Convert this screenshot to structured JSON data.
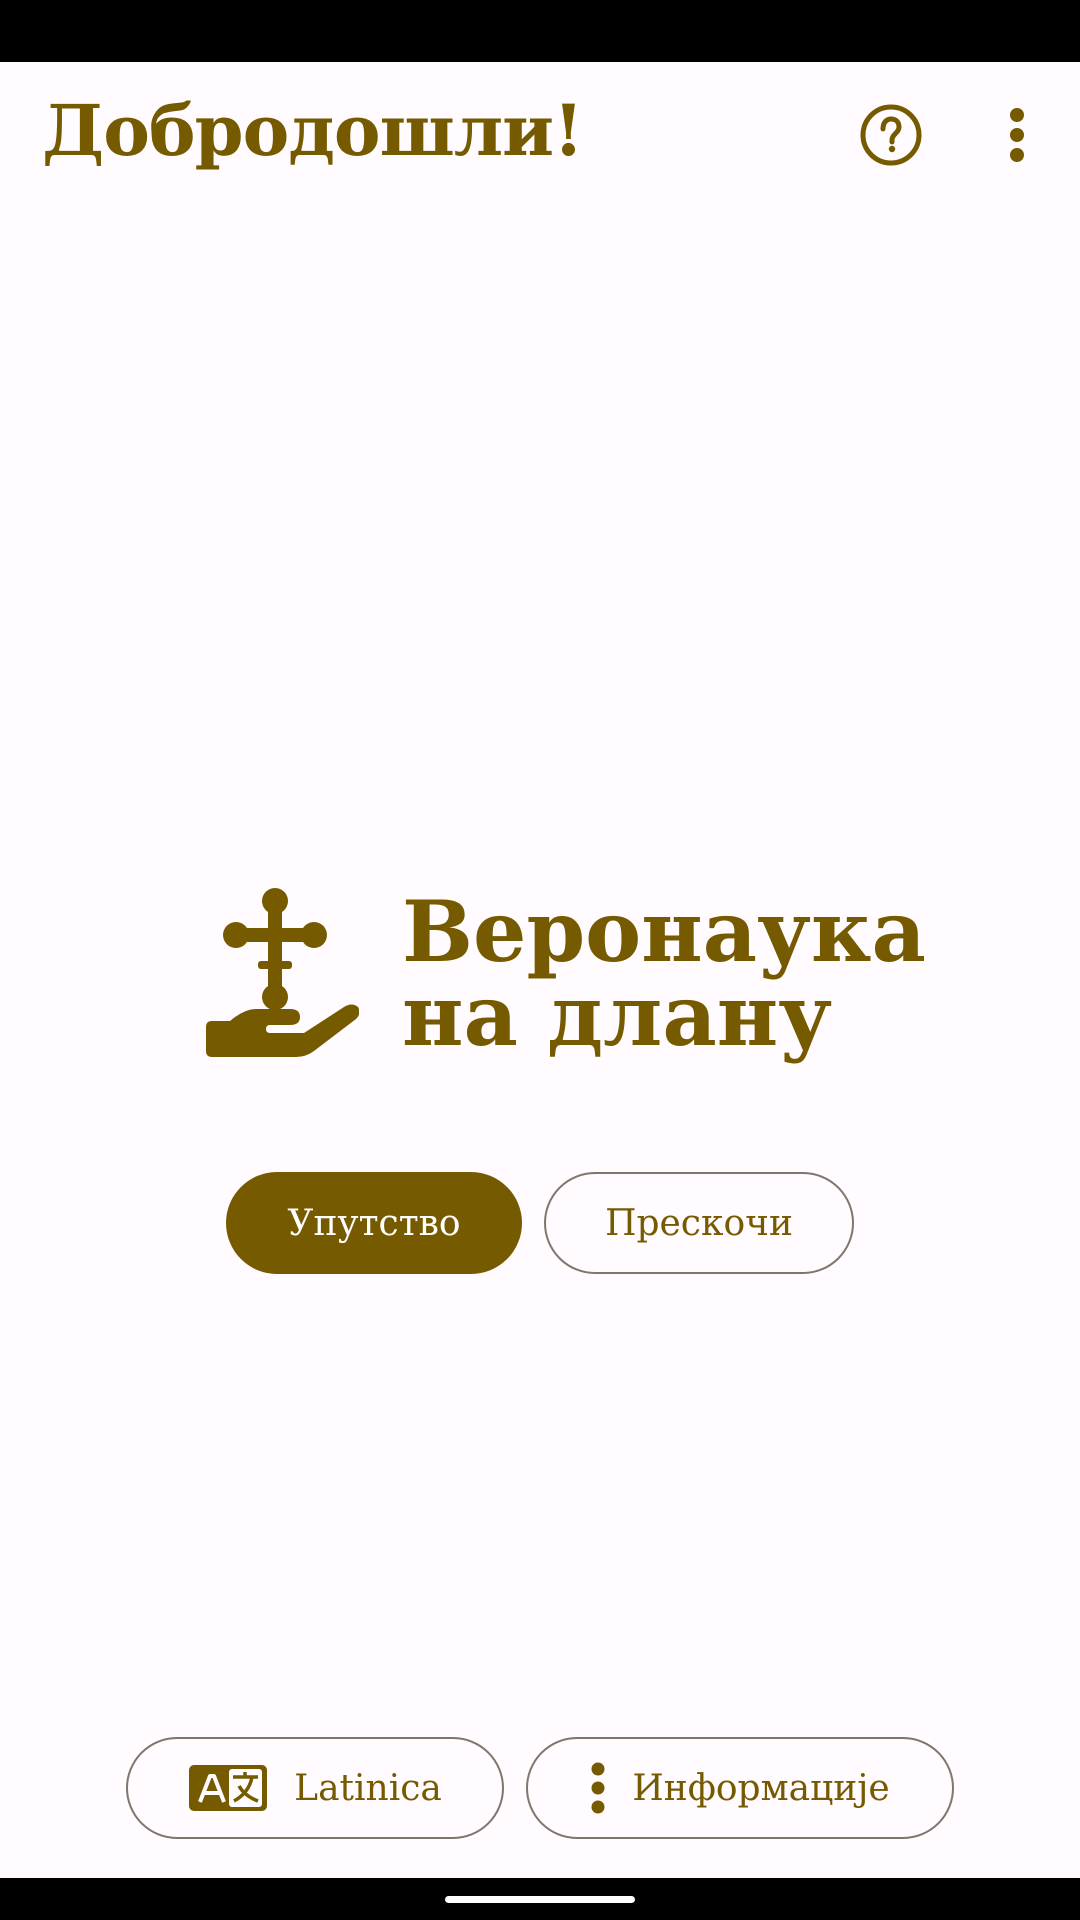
{
  "header": {
    "title": "Добродошли!",
    "help_icon": "help-circle-icon",
    "menu_icon": "more-vert-icon"
  },
  "logo": {
    "icon": "hand-cross-icon",
    "line1": "Веронаука",
    "line2": "на длану"
  },
  "actions": {
    "guide_label": "Упутство",
    "skip_label": "Прескочи"
  },
  "footer": {
    "latin_label": "Latinica",
    "latin_icon": "translate-icon",
    "info_label": "Информације",
    "info_icon": "more-vert-icon"
  },
  "colors": {
    "primary": "#765a00",
    "background": "#fffbfe",
    "outline": "#7d776c"
  }
}
